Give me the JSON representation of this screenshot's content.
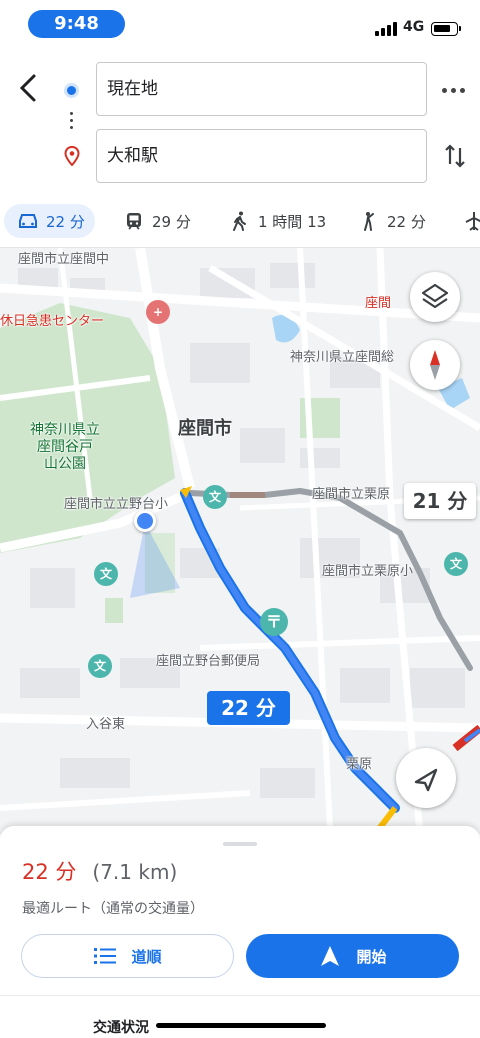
{
  "status": {
    "time": "9:48",
    "network": "4G"
  },
  "search": {
    "origin": "現在地",
    "destination": "大和駅"
  },
  "modes": [
    {
      "name": "car",
      "label": "22 分",
      "active": true
    },
    {
      "name": "transit",
      "label": "29 分",
      "active": false
    },
    {
      "name": "walk",
      "label": "1 時間 13",
      "active": false
    },
    {
      "name": "ride",
      "label": "22 分",
      "active": false
    }
  ],
  "map": {
    "labels": {
      "city": "座間市",
      "park": "神奈川県立\n座間谷戸\n山公園",
      "clinic": "休日急患センター",
      "school_top": "座間市立座間中",
      "school_left": "座間市立立野台小",
      "school_right": "座間市立栗原",
      "school_right2": "座間市立栗原小",
      "highschool": "神奈川県立座間総",
      "post": "座間立野台郵便局",
      "area": "入谷東",
      "station_top": "座間",
      "station_bottom": "栗原",
      "school_pin": "文",
      "post_pin": "〒",
      "hospital_pin": "+"
    },
    "route_callout": "22 分",
    "alt_callout": "21 分"
  },
  "summary": {
    "time": "22 分",
    "distance": "(7.1 km)",
    "description": "最適ルート（通常の交通量）"
  },
  "buttons": {
    "steps": "道順",
    "start": "開始"
  },
  "footer": {
    "traffic": "交通状況"
  },
  "colors": {
    "accent": "#1a73e8",
    "eta": "#d93025",
    "route": "#4285f4",
    "alt_route": "#9aa0a6"
  }
}
